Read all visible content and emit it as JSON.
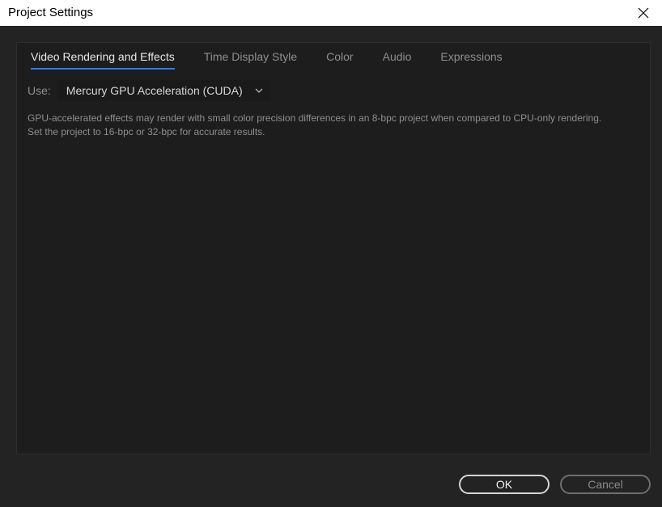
{
  "window": {
    "title": "Project Settings",
    "close_icon": "close-icon"
  },
  "tabs": [
    {
      "label": "Video Rendering and Effects",
      "active": true
    },
    {
      "label": "Time Display Style",
      "active": false
    },
    {
      "label": "Color",
      "active": false
    },
    {
      "label": "Audio",
      "active": false
    },
    {
      "label": "Expressions",
      "active": false
    }
  ],
  "renderer": {
    "label": "Use:",
    "selected": "Mercury GPU Acceleration (CUDA)",
    "chevron_icon": "chevron-down-icon"
  },
  "info": {
    "text": "GPU-accelerated effects may render with small color precision differences in an 8-bpc project when compared to CPU-only rendering. Set the project to 16-bpc or 32-bpc for accurate results."
  },
  "buttons": {
    "ok_label": "OK",
    "cancel_label": "Cancel"
  },
  "colors": {
    "accent": "#2680eb",
    "background": "#232323",
    "panel": "#1d1d1d"
  }
}
